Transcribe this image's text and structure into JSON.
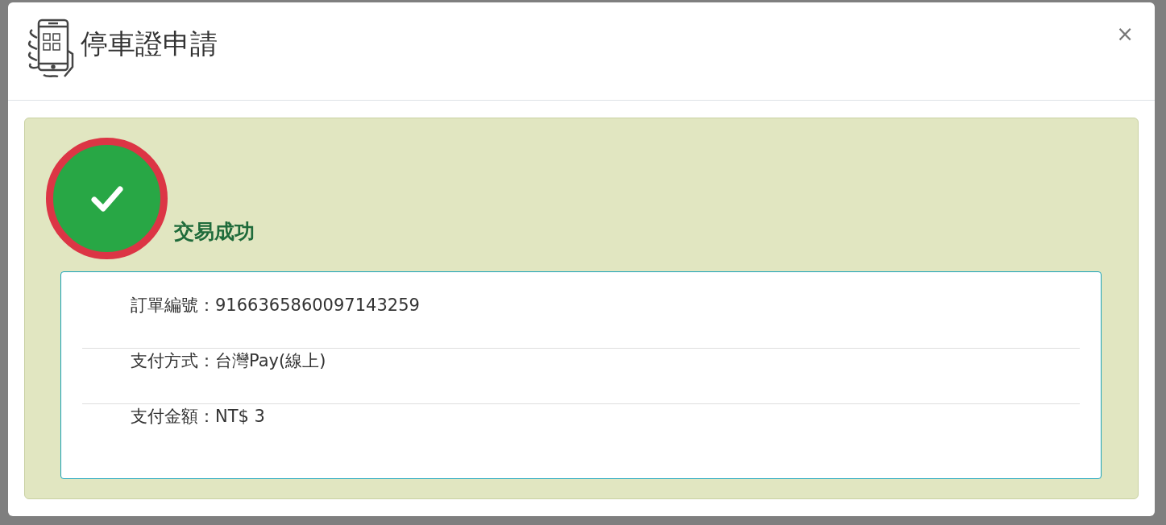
{
  "modal": {
    "title": "停車證申請",
    "close": "×"
  },
  "result": {
    "success": true,
    "message": "交易成功"
  },
  "details": [
    {
      "text": "訂單編號：9166365860097143259"
    },
    {
      "text": "支付方式：台灣Pay(線上)"
    },
    {
      "text": "支付金額：NT$ 3"
    }
  ]
}
